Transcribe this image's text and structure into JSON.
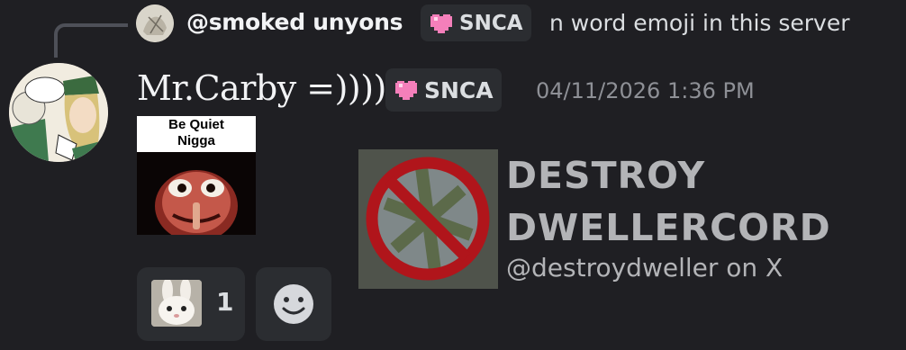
{
  "reply": {
    "username": "@smoked unyons",
    "tag": "SNCA",
    "text": "n word emoji in this server"
  },
  "message": {
    "author": "Mr.Carby =))))",
    "tag": "SNCA",
    "timestamp": "04/11/2026 1:36 PM",
    "meme_caption_line1": "Be Quiet",
    "meme_caption_line2": "Nigga"
  },
  "embed": {
    "title_line1": "DESTROY",
    "title_line2": "DWELLERCORD",
    "subtitle": "@destroydweller on X"
  },
  "reactions": [
    {
      "emoji": "rabbit-emoji",
      "count": "1"
    }
  ],
  "colors": {
    "background": "#1f1f23",
    "tag_bg": "#2b2d31",
    "heart": "#f47fba",
    "muted": "#8e9096"
  }
}
